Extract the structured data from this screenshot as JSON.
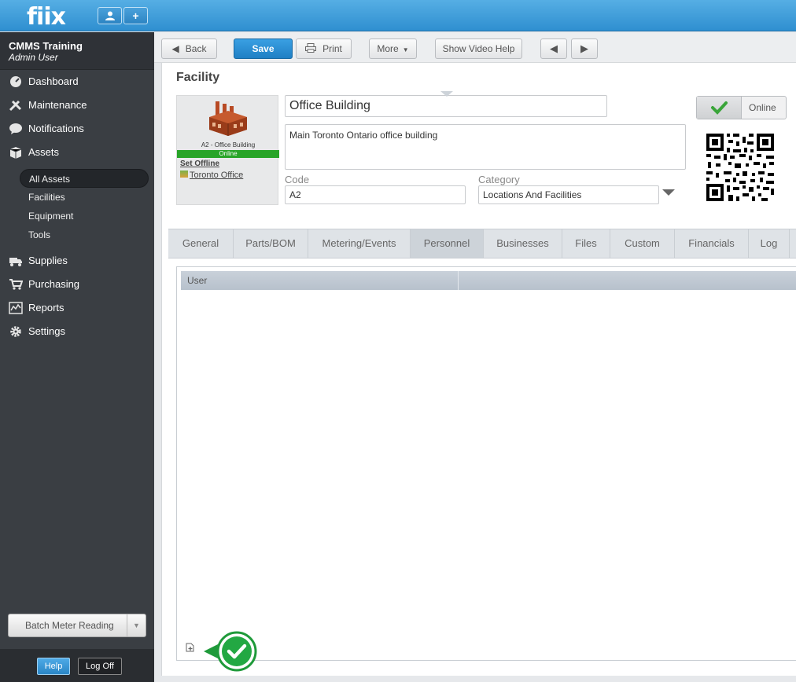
{
  "app": {
    "logo": "fiix"
  },
  "header": {
    "user_button_icon": "user-icon",
    "add_button_label": "+"
  },
  "user": {
    "org": "CMMS Training",
    "role": "Admin User"
  },
  "nav": {
    "items": [
      {
        "label": "Dashboard",
        "icon": "dashboard-icon"
      },
      {
        "label": "Maintenance",
        "icon": "tools-icon"
      },
      {
        "label": "Notifications",
        "icon": "chat-icon"
      },
      {
        "label": "Assets",
        "icon": "box-icon"
      },
      {
        "label": "Supplies",
        "icon": "truck-icon"
      },
      {
        "label": "Purchasing",
        "icon": "cart-icon"
      },
      {
        "label": "Reports",
        "icon": "chart-icon"
      },
      {
        "label": "Settings",
        "icon": "gear-icon"
      }
    ],
    "asset_subitems": [
      {
        "label": "All Assets"
      },
      {
        "label": "Facilities"
      },
      {
        "label": "Equipment"
      },
      {
        "label": "Tools"
      }
    ]
  },
  "sidebar_footer": {
    "batch_label": "Batch Meter Reading",
    "help_label": "Help",
    "logoff_label": "Log Off"
  },
  "toolbar": {
    "back_label": "Back",
    "save_label": "Save",
    "print_label": "Print",
    "more_label": "More",
    "video_help_label": "Show Video Help"
  },
  "facility": {
    "section_title": "Facility",
    "name": "Office Building",
    "description": "Main Toronto Ontario office building",
    "code_label": "Code",
    "code": "A2",
    "category_label": "Category",
    "category": "Locations And Facilities",
    "card_caption": "A2 - Office Building",
    "card_status": "Online",
    "set_offline_label": "Set Offline",
    "location_link": "Toronto Office",
    "online_toggle_label": "Online"
  },
  "tabs": [
    {
      "label": "General"
    },
    {
      "label": "Parts/BOM"
    },
    {
      "label": "Metering/Events"
    },
    {
      "label": "Personnel"
    },
    {
      "label": "Businesses"
    },
    {
      "label": "Files"
    },
    {
      "label": "Custom"
    },
    {
      "label": "Financials"
    },
    {
      "label": "Log"
    }
  ],
  "personnel_grid": {
    "columns": [
      "User",
      ""
    ]
  },
  "colors": {
    "accent": "#2f8fd0",
    "online_green": "#28a428",
    "sidebar": "#3a3e43"
  }
}
